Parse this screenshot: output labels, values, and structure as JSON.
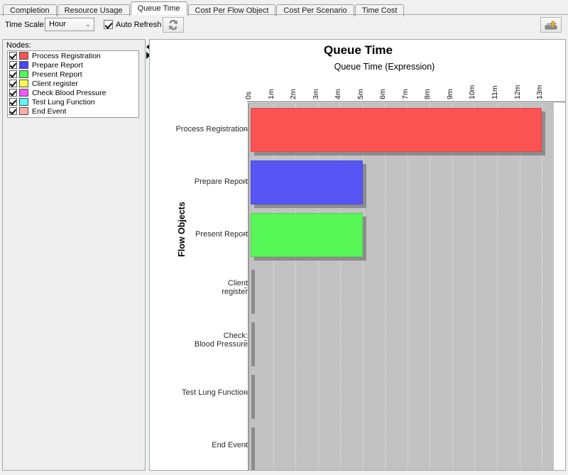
{
  "tabs": [
    {
      "label": "Completion",
      "active": false
    },
    {
      "label": "Resource Usage",
      "active": false
    },
    {
      "label": "Queue Time",
      "active": true
    },
    {
      "label": "Cost Per Flow Object",
      "active": false
    },
    {
      "label": "Cost Per Scenario",
      "active": false
    },
    {
      "label": "Time Cost",
      "active": false
    }
  ],
  "toolbar": {
    "time_scale_label": "Time Scale:",
    "time_scale_value": "Hour",
    "time_scale_options": [
      "Hour"
    ],
    "dropdown_arrow": "⌄",
    "auto_refresh_label": "Auto Refresh",
    "auto_refresh_checked": true,
    "refresh_button_icon": "refresh-icon",
    "export_button_icon": "export-icon"
  },
  "sidebar": {
    "nodes_label": "Nodes:",
    "nodes": [
      {
        "label": "Process Registration",
        "color": "#FB5252",
        "checked": true
      },
      {
        "label": "Prepare Report",
        "color": "#4A46F0",
        "checked": true
      },
      {
        "label": "Present Report",
        "color": "#55F655",
        "checked": true
      },
      {
        "label": "Client register",
        "color": "#FCFC4F",
        "checked": true
      },
      {
        "label": "Check Blood Pressure",
        "color": "#F955F9",
        "checked": true
      },
      {
        "label": "Test Lung Function",
        "color": "#5BF9F9",
        "checked": true
      },
      {
        "label": "End Event",
        "color": "#FCAEA8",
        "checked": true
      }
    ]
  },
  "splitter": {
    "collapse_icon": "triangle-left-icon",
    "expand_icon": "triangle-right-icon"
  },
  "chart_data": {
    "type": "bar",
    "orientation": "horizontal",
    "title": "Queue Time",
    "subtitle": "Queue Time (Expression)",
    "xlabel": "Queue Time (Expression)",
    "ylabel": "Flow Objects",
    "grid": true,
    "legend": "none",
    "xlim": [
      0,
      13.6
    ],
    "xunit": "minutes",
    "xtick_labels": [
      "0s",
      "1m",
      "2m",
      "3m",
      "4m",
      "5m",
      "6m",
      "7m",
      "8m",
      "9m",
      "10m",
      "11m",
      "12m",
      "13m"
    ],
    "xtick_values": [
      0,
      1,
      2,
      3,
      4,
      5,
      6,
      7,
      8,
      9,
      10,
      11,
      12,
      13
    ],
    "categories": [
      "Process Registration",
      "Prepare Report",
      "Present Report",
      "Client register",
      "Check: Blood Pressure",
      "Test Lung Function",
      "End Event"
    ],
    "category_lines": [
      [
        "Process Registration"
      ],
      [
        "Prepare Report"
      ],
      [
        "Present Report"
      ],
      [
        "Client",
        "register"
      ],
      [
        "Check:",
        "Blood Pressure"
      ],
      [
        "Test Lung Function"
      ],
      [
        "End Event"
      ]
    ],
    "values": [
      13.0,
      5.0,
      5.0,
      0,
      0,
      0,
      0
    ],
    "bar_colors": [
      "#FB5252",
      "#5756F4",
      "#55F656",
      "#FCFC4F",
      "#F955F9",
      "#5BF9F9",
      "#FCAEA8"
    ],
    "plot_background": "#C2C2C2",
    "bar_shadow_color": "#8C8C8C"
  }
}
